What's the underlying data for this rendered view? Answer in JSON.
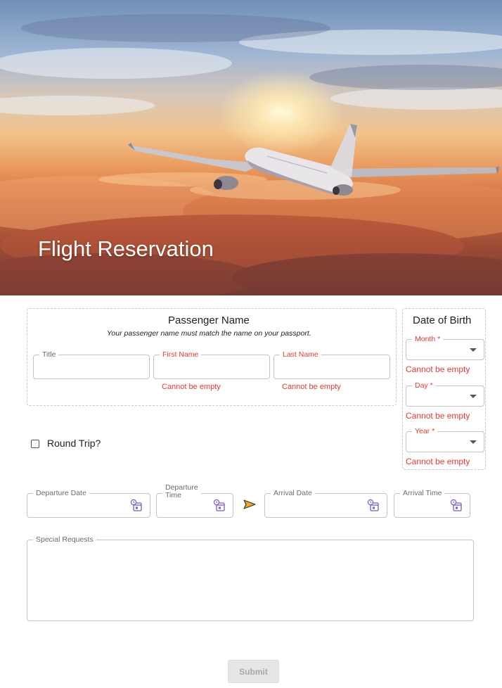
{
  "hero": {
    "title": "Flight Reservation"
  },
  "passenger": {
    "title": "Passenger Name",
    "subtitle": "Your passenger name must match the name on your passport.",
    "fields": {
      "title_label": "Title",
      "first_label": "First Name",
      "last_label": "Last Name",
      "first_error": "Cannot be empty",
      "last_error": "Cannot be empty"
    }
  },
  "dob": {
    "title": "Date of Birth",
    "month_label": "Month *",
    "day_label": "Day *",
    "year_label": "Year *",
    "month_error": "Cannot be empty",
    "day_error": "Cannot be empty",
    "year_error": "Cannot be empty"
  },
  "round_trip": {
    "label": "Round Trip?",
    "checked": false
  },
  "travel": {
    "departure_date_label": "Departure Date",
    "departure_time_label_line1": "Departure",
    "departure_time_label_line2": "Time",
    "arrival_date_label": "Arrival Date",
    "arrival_time_label": "Arrival Time"
  },
  "special_requests": {
    "label": "Special Requests"
  },
  "submit": {
    "label": "Submit"
  },
  "colors": {
    "error": "#e53935",
    "arrow_fill": "#f5a623",
    "calendar_icon": "#7b5cc7"
  },
  "icons": {
    "calendar": "calendar-clock-icon",
    "arrow": "right-arrow-icon",
    "dropdown": "chevron-down-icon"
  }
}
